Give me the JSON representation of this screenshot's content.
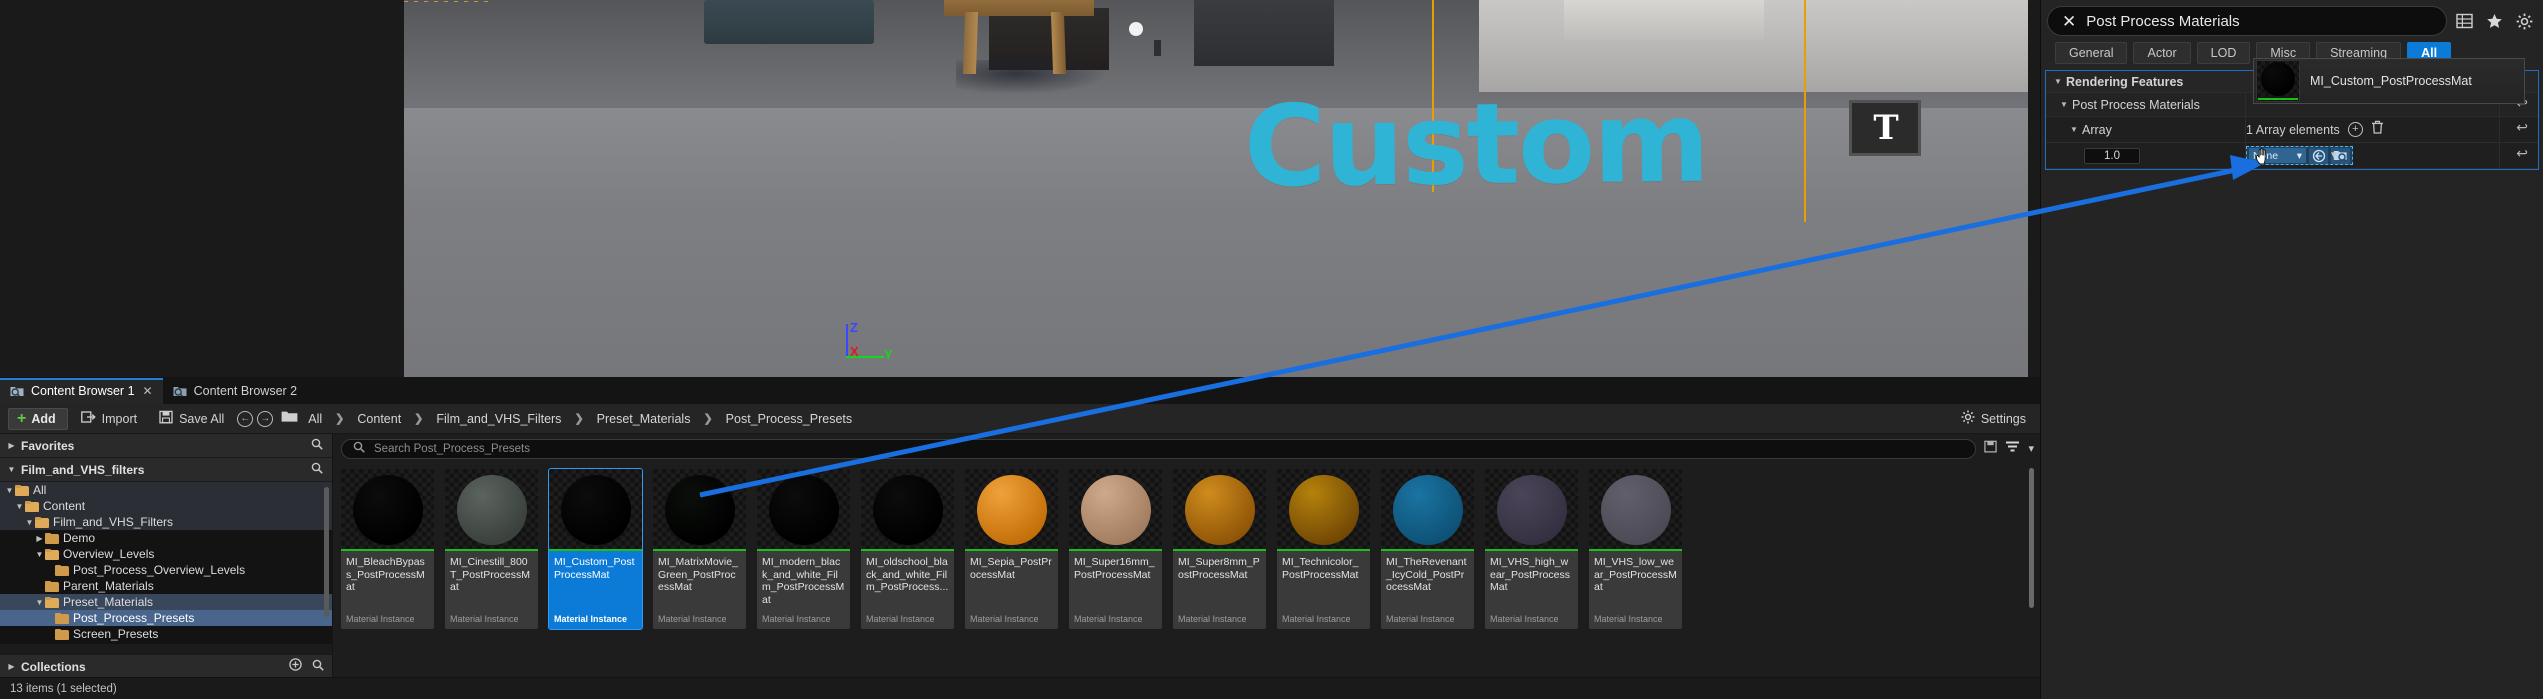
{
  "viewport": {
    "overlay_text": "Custom",
    "overlay_color": "#2fb4d6",
    "text_widget_glyph": "T",
    "axis": {
      "x": "X",
      "y": "Y",
      "z": "Z"
    }
  },
  "details_panel": {
    "close_icon": "close-icon",
    "title": "Post Process Materials",
    "header_icons": [
      "table-icon",
      "star-icon",
      "gear-icon"
    ],
    "tabs": [
      {
        "label": "General",
        "active": false
      },
      {
        "label": "Actor",
        "active": false
      },
      {
        "label": "LOD",
        "active": false
      },
      {
        "label": "Misc",
        "active": false
      },
      {
        "label": "Streaming",
        "active": false
      },
      {
        "label": "All",
        "active": true
      }
    ],
    "accent_color": "#0c7bd8",
    "rows": {
      "rendering_features": "Rendering Features",
      "post_process_materials": "Post Process Materials",
      "array": "Array",
      "array_elements": "1 Array elements",
      "add_icon": "plus-circle-icon",
      "delete_icon": "trash-icon",
      "weight_value": "1.0",
      "picker_value": "None",
      "browse_icon": "browse-to-asset-icon",
      "find_icon": "find-in-content-browser-icon",
      "revert_icon": "revert-arrow-icon"
    },
    "asset_preview": {
      "name": "MI_Custom_PostProcessMat",
      "thumbnail": "black-sphere-thumbnail",
      "type_bar_color": "#17c217"
    }
  },
  "content_browser": {
    "tabs": [
      {
        "label": "Content Browser 1",
        "active": true,
        "closable": true
      },
      {
        "label": "Content Browser 2",
        "active": false,
        "closable": false
      }
    ],
    "toolbar": {
      "add_label": "Add",
      "import_label": "Import",
      "save_all_label": "Save All",
      "back_icon": "back-arrow-icon",
      "forward_icon": "forward-arrow-icon",
      "folder_icon": "folder-icon",
      "settings_label": "Settings",
      "settings_icon": "gear-icon"
    },
    "breadcrumb": [
      "All",
      "Content",
      "Film_and_VHS_Filters",
      "Preset_Materials",
      "Post_Process_Presets"
    ],
    "sidebar": {
      "favorites_label": "Favorites",
      "project_label": "Film_and_VHS_filters",
      "collections_label": "Collections",
      "search_icon": "search-icon",
      "add_icon": "plus-circle-icon",
      "tree": [
        {
          "label": "All",
          "depth": 0,
          "expanded": true,
          "state": "soft"
        },
        {
          "label": "Content",
          "depth": 1,
          "expanded": true,
          "state": "soft"
        },
        {
          "label": "Film_and_VHS_Filters",
          "depth": 2,
          "expanded": true,
          "state": "soft"
        },
        {
          "label": "Demo",
          "depth": 3,
          "expanded": false,
          "state": "none"
        },
        {
          "label": "Overview_Levels",
          "depth": 3,
          "expanded": true,
          "state": "none"
        },
        {
          "label": "Post_Process_Overview_Levels",
          "depth": 4,
          "expanded": null,
          "state": "none"
        },
        {
          "label": "Parent_Materials",
          "depth": 3,
          "expanded": null,
          "state": "none"
        },
        {
          "label": "Preset_Materials",
          "depth": 3,
          "expanded": true,
          "state": "row"
        },
        {
          "label": "Post_Process_Presets",
          "depth": 4,
          "expanded": null,
          "state": "selected"
        },
        {
          "label": "Screen_Presets",
          "depth": 4,
          "expanded": null,
          "state": "none"
        }
      ]
    },
    "search": {
      "placeholder": "Search Post_Process_Presets",
      "value": ""
    },
    "search_icons": [
      "save-search-icon",
      "filter-icon",
      "chevron-down-icon"
    ],
    "assets": [
      {
        "name": "MI_BleachBypass_PostProcessMat",
        "type": "Material Instance",
        "color": "#000000",
        "selected": false
      },
      {
        "name": "MI_Cinestill_800T_PostProcessMat",
        "type": "Material Instance",
        "color": "#4c5450",
        "selected": false
      },
      {
        "name": "MI_Custom_PostProcessMat",
        "type": "Material Instance",
        "color": "#000000",
        "selected": true
      },
      {
        "name": "MI_MatrixMovie_Green_PostProcessMat",
        "type": "Material Instance",
        "color": "#050705",
        "selected": false
      },
      {
        "name": "MI_modern_black_and_white_Film_PostProcessMat",
        "type": "Material Instance",
        "color": "#000000",
        "selected": false
      },
      {
        "name": "MI_oldschool_black_and_white_Film_PostProcess...",
        "type": "Material Instance",
        "color": "#000000",
        "selected": false
      },
      {
        "name": "MI_Sepia_PostProcessMat",
        "type": "Material Instance",
        "color": "#d4821c",
        "selected": false
      },
      {
        "name": "MI_Super16mm_PostProcessMat",
        "type": "Material Instance",
        "color": "#b9957a",
        "selected": false
      },
      {
        "name": "MI_Super8mm_PostProcessMat",
        "type": "Material Instance",
        "color": "#b46f16",
        "selected": false
      },
      {
        "name": "MI_Technicolor_PostProcessMat",
        "type": "Material Instance",
        "color": "#9c6a08",
        "selected": false
      },
      {
        "name": "MI_TheRevenant_IcyCold_PostProcessMat",
        "type": "Material Instance",
        "color": "#136288",
        "selected": false
      },
      {
        "name": "MI_VHS_high_wear_PostProcessMat",
        "type": "Material Instance",
        "color": "#3e3a4e",
        "selected": false
      },
      {
        "name": "MI_VHS_low_wear_PostProcessMat",
        "type": "Material Instance",
        "color": "#55545f",
        "selected": false
      }
    ],
    "status": "13 items (1 selected)"
  },
  "annotation": {
    "arrow_color": "#1a6fe0"
  }
}
